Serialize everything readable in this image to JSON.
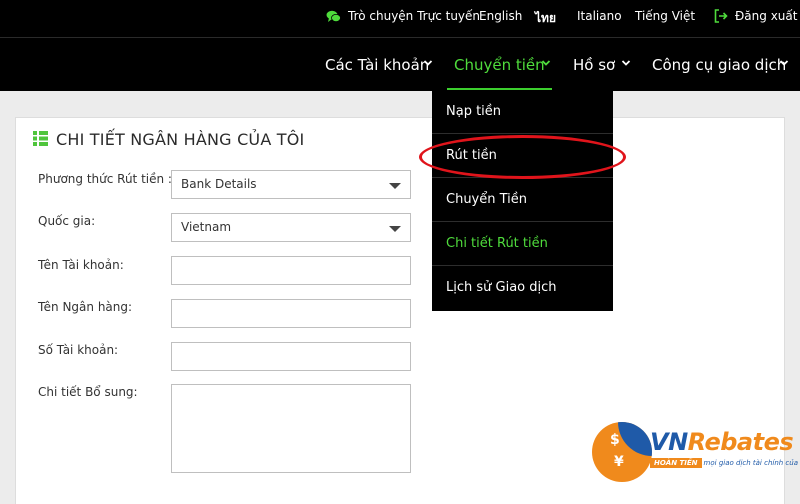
{
  "topbar": {
    "chat_label": "Trò chuyện Trực tuyến",
    "languages": [
      "English",
      "ไทย",
      "Italiano",
      "Tiếng Việt"
    ],
    "logout_label": "Đăng xuất",
    "chat_icon": "chat-bubble-icon",
    "logout_icon": "logout-icon",
    "accent_color": "#4fdc3c"
  },
  "nav": {
    "items": [
      {
        "label": "Các Tài khoản"
      },
      {
        "label": "Chuyển tiền",
        "active": true
      },
      {
        "label": "Hồ sơ"
      },
      {
        "label": "Công cụ giao dịch"
      }
    ]
  },
  "dropdown": {
    "items": [
      {
        "label": "Nạp tiền"
      },
      {
        "label": "Rút tiền",
        "circled": true
      },
      {
        "label": "Chuyển Tiền"
      },
      {
        "label": "Chi tiết Rút tiền",
        "highlighted": true
      },
      {
        "label": "Lịch sử Giao dịch"
      }
    ],
    "annotation_color": "#e0141b"
  },
  "panel": {
    "title": "CHI TIẾT NGÂN HÀNG CỦA TÔI",
    "title_icon": "list-icon",
    "fields": {
      "method_label": "Phương thức Rút tiền :",
      "method_value": "Bank Details",
      "country_label": "Quốc gia:",
      "country_value": "Vietnam",
      "account_name_label": "Tên Tài khoản:",
      "account_name_value": "",
      "bank_name_label": "Tên Ngân hàng:",
      "bank_name_value": "",
      "account_number_label": "Số Tài khoản:",
      "account_number_value": "",
      "details_label": "Chi tiết Bổ sung:",
      "details_value": ""
    }
  },
  "watermark": {
    "brand_vn": "VN",
    "brand_rebates": "Rebates",
    "tag_pill": "HOÀN TIỀN",
    "tag_rest": "mọi giao dịch tài chính của bạn",
    "colors": {
      "blue": "#1f5aa8",
      "orange": "#f08a1c"
    }
  }
}
